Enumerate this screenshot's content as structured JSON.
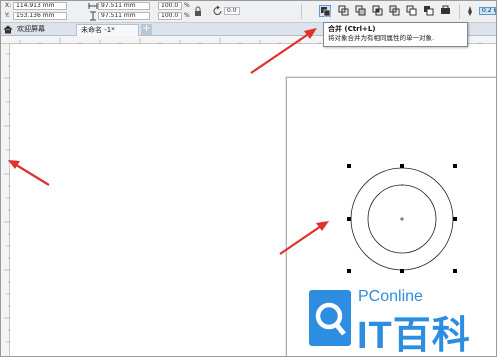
{
  "property_bar": {
    "x_label": "X:",
    "x_value": "114.913 mm",
    "y_label": "Y:",
    "y_value": "153.136 mm",
    "width_value": "97.511 mm",
    "height_value": "97.511 mm",
    "scale_w": "100.0",
    "scale_h": "100.0",
    "percent_sign": "%",
    "rotation_value": "0.0",
    "outline_value": "0.2 mm",
    "combine_icon": "combine-icon",
    "icons": [
      "lock-ratio-icon",
      "rotate-icon",
      "combine-icon",
      "weld-icon",
      "trim-icon",
      "intersect-icon",
      "simplify-icon",
      "front-minus-back-icon",
      "back-minus-front-icon",
      "create-boundary-icon",
      "outline-pen-icon"
    ]
  },
  "tabs": [
    {
      "label": "欢迎屏幕",
      "icon": "home-icon"
    },
    {
      "label": "未命名 -1*"
    }
  ],
  "tooltip": {
    "title": "合并 (Ctrl+L)",
    "description": "将对象合并为有相同属性的单一对象."
  },
  "watermark": {
    "text": "PConline",
    "brand": "IT百科",
    "logo": "pconline-logo"
  },
  "colors": {
    "arrow": "#e0312b",
    "accent": "#2d8de0"
  }
}
